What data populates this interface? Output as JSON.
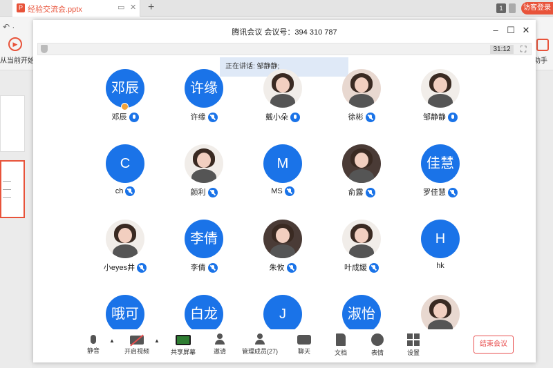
{
  "wps": {
    "tab_title": "经验交流会.pptx",
    "tab_icon_letter": "P",
    "badge_count": "1",
    "guest_login": "访客登录",
    "play_label": "从当前开始",
    "right_label": "助手"
  },
  "meeting": {
    "title": "腾讯会议 会议号：394 310 787",
    "timer": "31:12",
    "speaking": "正在讲话: 邹静静;",
    "participants": [
      {
        "name": "邓辰",
        "avatar_text": "邓辰",
        "photo": false,
        "mic": "on",
        "host": true
      },
      {
        "name": "许缘",
        "avatar_text": "许缘",
        "photo": false,
        "mic": "off"
      },
      {
        "name": "戴小朵",
        "avatar_text": "",
        "photo": true,
        "mic": "on"
      },
      {
        "name": "徐彬",
        "avatar_text": "",
        "photo": true,
        "mic": "off"
      },
      {
        "name": "邹静静",
        "avatar_text": "",
        "photo": true,
        "mic": "on"
      },
      {
        "name": "ch",
        "avatar_text": "C",
        "photo": false,
        "mic": "off"
      },
      {
        "name": "颜利",
        "avatar_text": "",
        "photo": true,
        "mic": "off"
      },
      {
        "name": "MS",
        "avatar_text": "M",
        "photo": false,
        "mic": "off"
      },
      {
        "name": "俞露",
        "avatar_text": "",
        "photo": true,
        "mic": "off"
      },
      {
        "name": "罗佳慧",
        "avatar_text": "佳慧",
        "photo": false,
        "mic": "off"
      },
      {
        "name": "小eyes井",
        "avatar_text": "",
        "photo": true,
        "mic": "off"
      },
      {
        "name": "李倩",
        "avatar_text": "李倩",
        "photo": false,
        "mic": "off"
      },
      {
        "name": "朱攸",
        "avatar_text": "",
        "photo": true,
        "mic": "off"
      },
      {
        "name": "叶成媛",
        "avatar_text": "",
        "photo": true,
        "mic": "off"
      },
      {
        "name": "hk",
        "avatar_text": "H",
        "photo": false,
        "mic": "none"
      },
      {
        "name": "",
        "avatar_text": "哦可",
        "photo": false,
        "mic": "none"
      },
      {
        "name": "",
        "avatar_text": "白龙",
        "photo": false,
        "mic": "none"
      },
      {
        "name": "",
        "avatar_text": "J",
        "photo": false,
        "mic": "none"
      },
      {
        "name": "",
        "avatar_text": "淑怡",
        "photo": false,
        "mic": "none"
      },
      {
        "name": "",
        "avatar_text": "",
        "photo": true,
        "mic": "none"
      }
    ],
    "toolbar": {
      "mute": "静音",
      "video": "开启视频",
      "share": "共享屏幕",
      "invite": "邀请",
      "manage": "管理成员(27)",
      "chat": "聊天",
      "doc": "文档",
      "emoji": "表情",
      "settings": "设置",
      "end": "结束会议"
    }
  }
}
